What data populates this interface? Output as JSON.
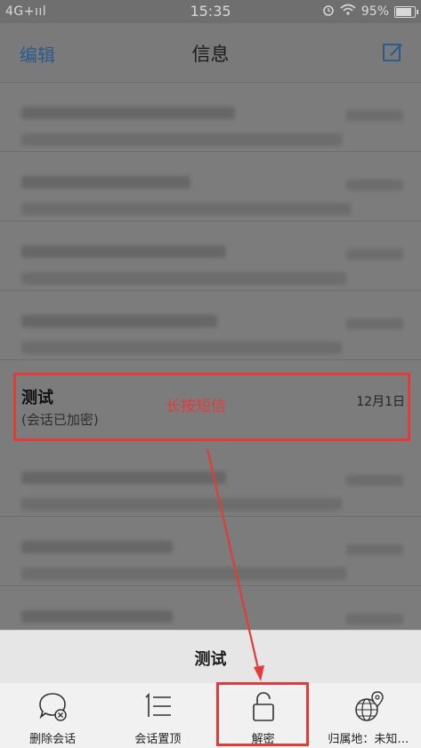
{
  "status_bar": {
    "left_text": "4G+ııl",
    "time": "15:35",
    "battery_text": "95%"
  },
  "nav": {
    "edit_label": "编辑",
    "title": "信息",
    "compose_icon": "compose-icon"
  },
  "conversation": {
    "title": "测试",
    "subtitle": "(会话已加密)",
    "date": "12月1日",
    "annotation": "长按短信"
  },
  "sheet": {
    "title": "测试",
    "actions": [
      {
        "label": "删除会话",
        "icon": "delete-chat-icon"
      },
      {
        "label": "会话置顶",
        "icon": "pin-top-icon"
      },
      {
        "label": "解密",
        "icon": "unlock-icon"
      },
      {
        "label": "归属地：未知…",
        "icon": "location-globe-icon"
      }
    ]
  },
  "colors": {
    "accent": "#2a5b8c",
    "annotation": "#e23b3b"
  }
}
